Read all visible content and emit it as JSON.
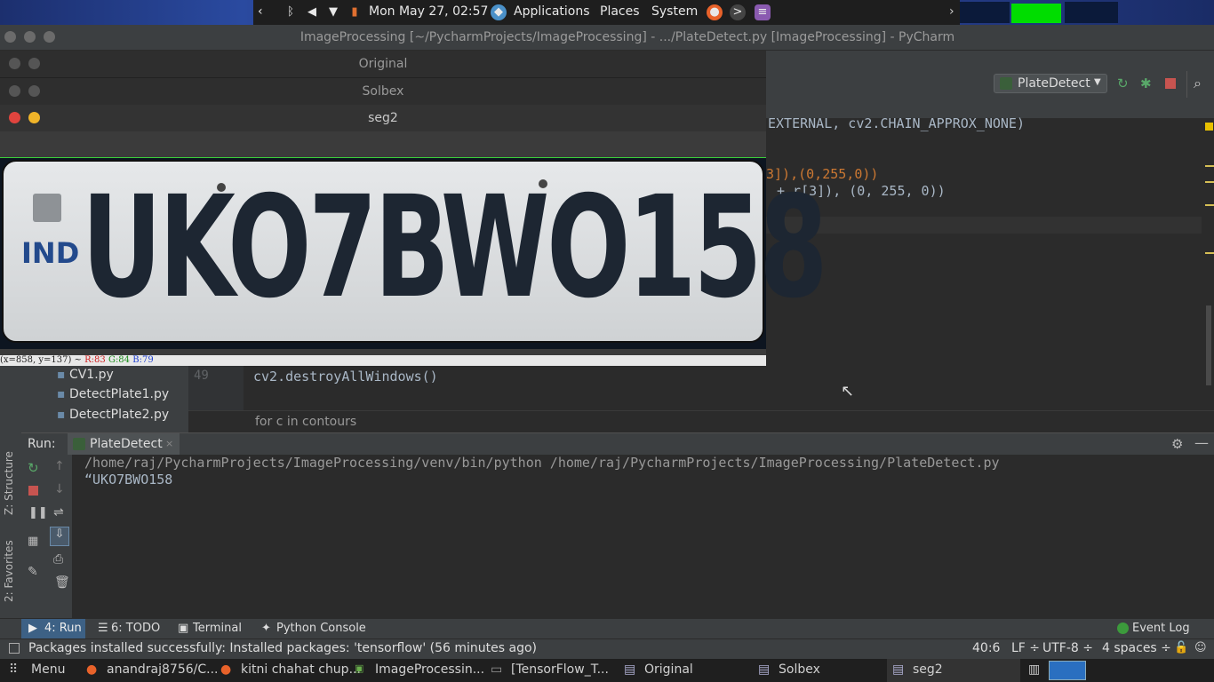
{
  "panel": {
    "datetime": "Mon May 27, 02:57",
    "menus": [
      "Applications",
      "Places",
      "System"
    ]
  },
  "pycharm": {
    "window_title": "ImageProcessing [~/PycharmProjects/ImageProcessing] - .../PlateDetect.py [ImageProcessing] - PyCharm",
    "run_config": "PlateDetect",
    "code_lines": {
      "l1": "EXTERNAL, cv2.CHAIN_APPROX_NONE)",
      "l2": "3]),(0,255,0))",
      "l3": "+ r[3]), (0, 255, 0))",
      "l4_num": "49",
      "l4": "cv2.destroyAllWindows()"
    },
    "breadcrumb": "for c in contours",
    "project_files": [
      "CV1.py",
      "DetectPlate1.py",
      "DetectPlate2.py"
    ],
    "left_tabs": [
      "Z: Structure",
      "2: Favorites"
    ],
    "run": {
      "label": "Run:",
      "tab": "PlateDetect",
      "cmd": "/home/raj/PycharmProjects/ImageProcessing/venv/bin/python /home/raj/PycharmProjects/ImageProcessing/PlateDetect.py",
      "output": "“UKO7BWO158"
    },
    "bottom_tabs": [
      "4: Run",
      "6: TODO",
      "Terminal",
      "Python Console"
    ],
    "event_log": "Event Log",
    "status": {
      "message": "Packages installed successfully: Installed packages: 'tensorflow' (56 minutes ago)",
      "position": "40:6",
      "line_sep": "LF ÷",
      "encoding": "UTF-8 ÷",
      "indent": "4 spaces ÷"
    }
  },
  "cv_windows": {
    "original": "Original",
    "solbex": "Solbex",
    "seg2": "seg2",
    "plate_text": "UKO7BWO158",
    "plate_ind": "IND",
    "coord_text": "(x=858, y=137) ~",
    "r_text": "R:83",
    "g_text": "G:84",
    "b_text": "B:79"
  },
  "taskbar": {
    "menu": "Menu",
    "items": [
      "anandraj8756/C...",
      "kitni chahat chup...",
      "ImageProcessin...",
      "[TensorFlow_T...",
      "Original",
      "Solbex",
      "seg2"
    ]
  }
}
